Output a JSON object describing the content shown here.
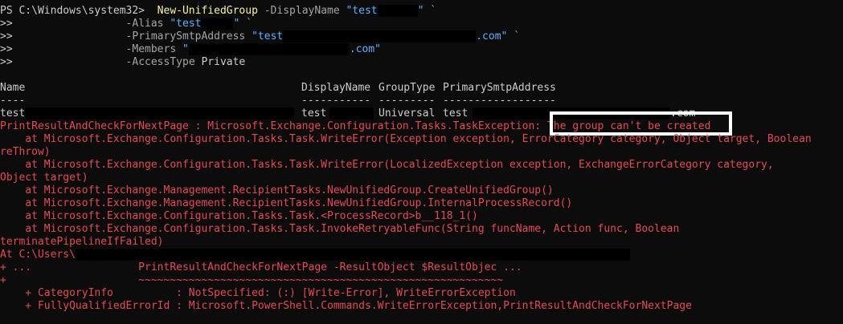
{
  "prompt": "PS C:\\Windows\\system32>",
  "cmd": {
    "name": "New-UnifiedGroup",
    "p_display": "-DisplayName",
    "v_display": "\"test",
    "v_display_end": "\"",
    "tick": "`",
    "cont": ">>",
    "p_alias": "-Alias",
    "v_alias": "\"test",
    "v_alias_end": "\"",
    "p_smtp": "-PrimarySmtpAddress",
    "v_smtp": "\"test",
    "v_smtp_end": ".com\"",
    "p_members": "-Members",
    "v_members": "\"",
    "v_members_end": ".com\"",
    "p_access": "-AccessType",
    "v_access": "Private"
  },
  "table": {
    "headers": [
      "Name",
      "DisplayName",
      "GroupType",
      "PrimarySmtpAddress"
    ],
    "dash_name": "----",
    "dash_display": "-----------",
    "dash_type": "---------",
    "dash_smtp": "------------------",
    "row_name": "test",
    "row_display": "test",
    "row_type": "Universal",
    "row_smtp": "test",
    "row_smtp_end": ".com"
  },
  "error": {
    "line1_prefix": "PrintResultAndCheckForNextPage : Microsoft.Exchange.Configuration.Tasks.TaskException:",
    "line1_msg": "The group can't be created",
    "l2": "    at Microsoft.Exchange.Configuration.Tasks.Task.WriteError(Exception exception, ErrorCategory category, Object target, Boolean",
    "l3": "reThrow)",
    "l4": "    at Microsoft.Exchange.Configuration.Tasks.Task.WriteError(LocalizedException exception, ExchangeErrorCategory category,",
    "l5": "Object target)",
    "l6": "    at Microsoft.Exchange.Management.RecipientTasks.NewUnifiedGroup.CreateUnifiedGroup()",
    "l7": "    at Microsoft.Exchange.Management.RecipientTasks.NewUnifiedGroup.InternalProcessRecord()",
    "l8": "    at Microsoft.Exchange.Configuration.Tasks.Task.<ProcessRecord>b__118_1()",
    "l9": "    at Microsoft.Exchange.Configuration.Tasks.Task.InvokeRetryableFunc(String funcName, Action func, Boolean",
    "l10": "terminatePipelineIfFailed)",
    "l11": "At C:\\Users\\",
    "l12": "+ ...                 PrintResultAndCheckForNextPage -ResultObject $ResultObjec ...",
    "l13": "+                     ~~~~~~~~~~~~~~~~~~~~~~~~~~~~~~~~~~~~~~~~~~~~~~~~~~~~~~~~~~",
    "l14": "    + CategoryInfo          : NotSpecified: (:) [Write-Error], WriteErrorException",
    "l15": "    + FullyQualifiedErrorId : Microsoft.PowerShell.Commands.WriteErrorException,PrintResultAndCheckForNextPage"
  }
}
